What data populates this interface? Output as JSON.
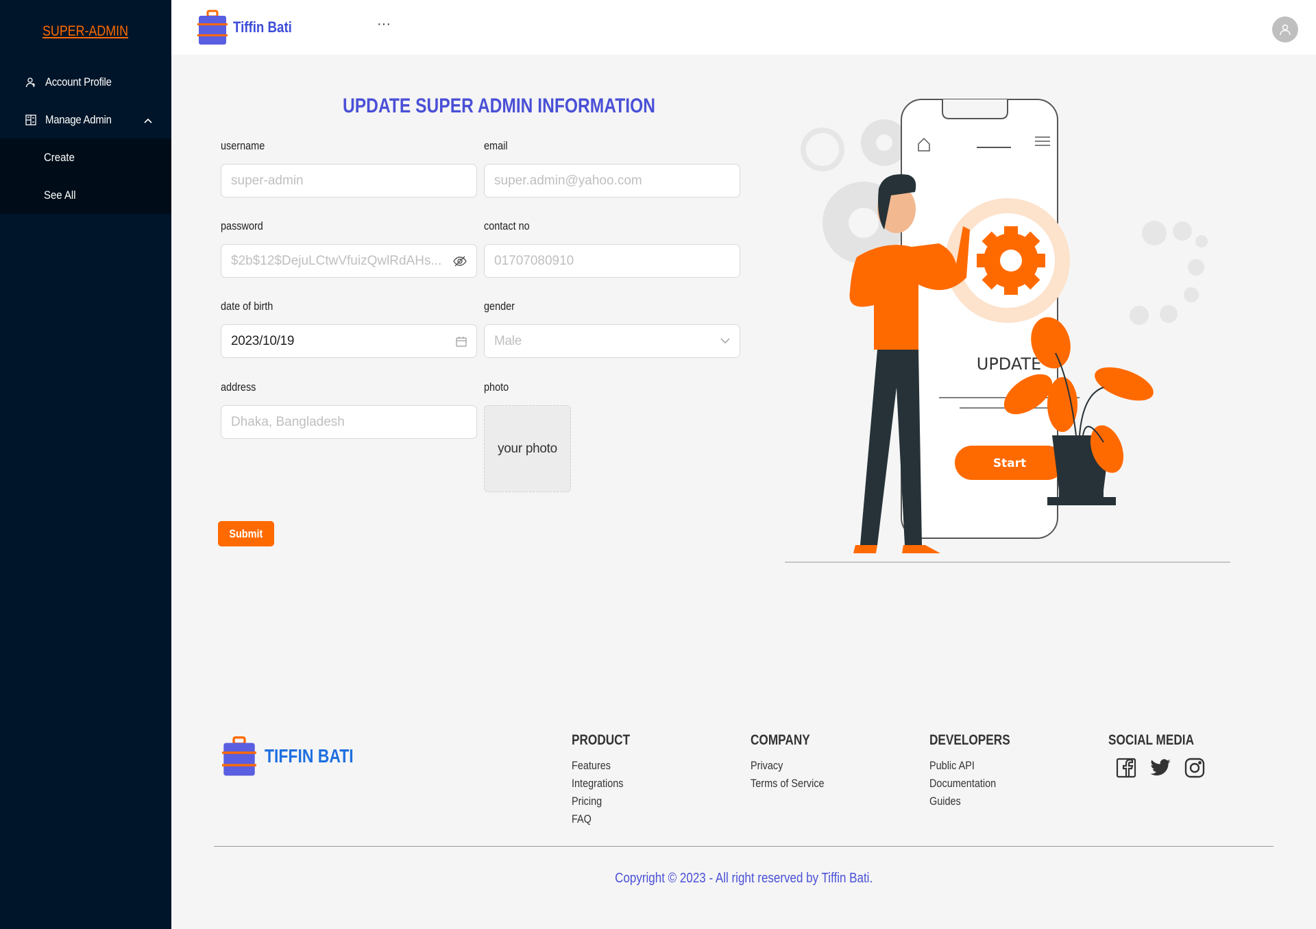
{
  "sidebar": {
    "brand": "SUPER-ADMIN",
    "items": [
      {
        "label": "Account Profile",
        "icon": "user-icon"
      },
      {
        "label": "Manage Admin",
        "icon": "admin-grid-icon"
      }
    ],
    "submenu": [
      "Create",
      "See All"
    ]
  },
  "header": {
    "app_name": "Tiffin Bati",
    "more": "···"
  },
  "form": {
    "title": "UPDATE SUPER ADMIN INFORMATION",
    "username": {
      "label": "username",
      "placeholder": "super-admin"
    },
    "email": {
      "label": "email",
      "placeholder": "super.admin@yahoo.com"
    },
    "password": {
      "label": "password",
      "placeholder": "$2b$12$DejuLCtwVfuizQwlRdAHs..."
    },
    "contact": {
      "label": "contact no",
      "placeholder": "01707080910"
    },
    "dob": {
      "label": "date of birth",
      "value": "2023/10/19"
    },
    "gender": {
      "label": "gender",
      "value": "Male"
    },
    "address": {
      "label": "address",
      "placeholder": "Dhaka, Bangladesh"
    },
    "photo": {
      "label": "photo",
      "text": "your photo"
    },
    "submit": "Submit"
  },
  "illustration": {
    "update_text": "UPDATE",
    "start_button": "Start",
    "accent": "#ff6a00"
  },
  "footer": {
    "brand": "TIFFIN BATI",
    "columns": [
      {
        "title": "PRODUCT",
        "links": [
          "Features",
          "Integrations",
          "Pricing",
          "FAQ"
        ]
      },
      {
        "title": "COMPANY",
        "links": [
          "Privacy",
          "Terms of Service"
        ]
      },
      {
        "title": "DEVELOPERS",
        "links": [
          "Public API",
          "Documentation",
          "Guides"
        ]
      },
      {
        "title": "SOCIAL MEDIA",
        "links": []
      }
    ],
    "social": [
      "facebook-icon",
      "twitter-icon",
      "instagram-icon"
    ],
    "copyright": "Copyright © 2023 - All right reserved by Tiffin Bati."
  },
  "colors": {
    "sidebar_bg": "#001529",
    "brand_orange": "#ff6a00",
    "primary_blue": "#4a50d6"
  }
}
